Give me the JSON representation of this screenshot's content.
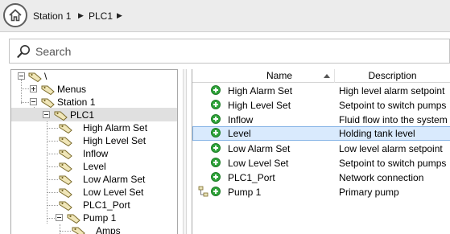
{
  "breadcrumb": {
    "items": [
      "Station 1",
      "PLC1"
    ],
    "separator": "▶"
  },
  "search": {
    "placeholder": "Search"
  },
  "tree": {
    "nodes": [
      {
        "label": "\\",
        "expander": "minus"
      },
      {
        "label": "Menus",
        "expander": "plus"
      },
      {
        "label": "Station 1",
        "expander": "minus"
      },
      {
        "label": "PLC1",
        "expander": "minus",
        "selected": true
      },
      {
        "label": "High Alarm Set"
      },
      {
        "label": "High Level Set"
      },
      {
        "label": "Inflow"
      },
      {
        "label": "Level"
      },
      {
        "label": "Low Alarm Set"
      },
      {
        "label": "Low Level Set"
      },
      {
        "label": "PLC1_Port"
      },
      {
        "label": "Pump 1",
        "expander": "minus"
      },
      {
        "label": "Amps"
      }
    ]
  },
  "list": {
    "columns": {
      "name": "Name",
      "description": "Description"
    },
    "sort": "ascending",
    "rows": [
      {
        "name": "High Alarm Set",
        "description": "High level alarm setpoint"
      },
      {
        "name": "High Level Set",
        "description": "Setpoint to switch pumps"
      },
      {
        "name": "Inflow",
        "description": "Fluid flow into the system"
      },
      {
        "name": "Level",
        "description": "Holding tank level",
        "selected": true
      },
      {
        "name": "Low Alarm Set",
        "description": "Low level alarm setpoint"
      },
      {
        "name": "Low Level Set",
        "description": "Setpoint to switch pumps"
      },
      {
        "name": "PLC1_Port",
        "description": "Network connection"
      },
      {
        "name": "Pump 1",
        "description": "Primary pump",
        "has_children": true
      }
    ]
  },
  "colors": {
    "toolbar_bg": "#ececec",
    "selection_bg": "#d9eafd",
    "selection_border": "#86b4e6",
    "add_icon": "#2fa43a",
    "tag_icon": "#f0e6b8"
  },
  "icons": {
    "home": "home-icon",
    "search": "search-icon",
    "tag": "tag-icon",
    "add": "add-circle-icon",
    "linked": "hierarchy-icon"
  }
}
